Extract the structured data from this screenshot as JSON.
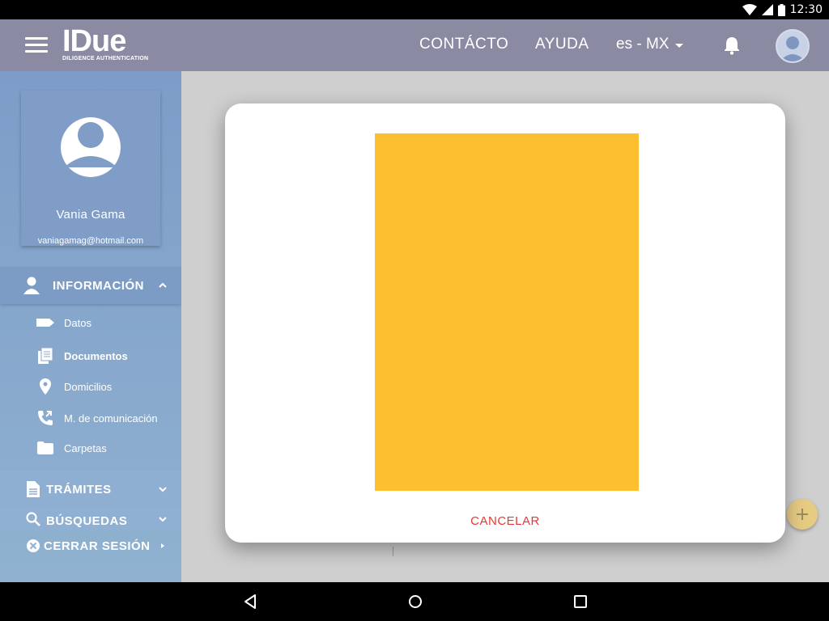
{
  "status_bar": {
    "time": "12:30"
  },
  "app_bar": {
    "logo_main": "IDue",
    "logo_sub": "DILIGENCE AUTHENTICATION",
    "nav_contact": "CONTÁCTO",
    "nav_help": "AYUDA",
    "language": "es - MX"
  },
  "sidebar": {
    "profile": {
      "name": "Vania Gama",
      "email": "vaniagamag@hotmail.com"
    },
    "info_section": {
      "label": "INFORMACIÓN",
      "items": [
        {
          "label": "Datos",
          "icon": "tag-icon"
        },
        {
          "label": "Documentos",
          "icon": "documents-icon"
        },
        {
          "label": "Domicilios",
          "icon": "location-pin-icon"
        },
        {
          "label": "M. de comunicación",
          "icon": "phone-forward-icon"
        },
        {
          "label": "Carpetas",
          "icon": "folder-icon"
        }
      ]
    },
    "tramites_label": "TRÁMITES",
    "busquedas_label": "BÚSQUEDAS",
    "logout_label": "CERRAR SESIÓN"
  },
  "modal": {
    "preview_color": "#fbbf2f",
    "cancel_label": "CANCELAR"
  },
  "colors": {
    "app_bar": "#8a8aa3",
    "sidebar": "#7d9cc8",
    "cancel": "#e53935",
    "fab": "#e6cb83"
  }
}
